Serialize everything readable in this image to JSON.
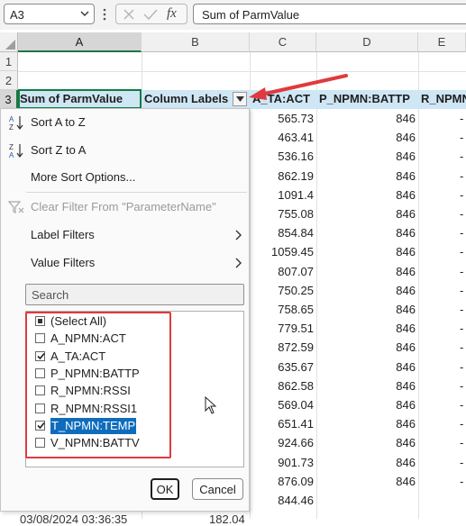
{
  "formula_bar": {
    "name_box": "A3",
    "fx_label": "fx",
    "formula": "Sum of ParmValue"
  },
  "grid": {
    "columns": [
      "A",
      "B",
      "C",
      "D",
      "E"
    ],
    "rows": [
      "1",
      "2",
      "3"
    ],
    "pivot_header": {
      "a3": "Sum of ParmValue",
      "b3": "Column Labels",
      "c3": "A_TA:ACT",
      "d3": "P_NPMN:BATTP",
      "e3": "R_NPMN"
    },
    "values_c": [
      "565.73",
      "463.41",
      "536.16",
      "862.19",
      "1091.4",
      "755.08",
      "854.84",
      "1059.45",
      "807.07",
      "750.25",
      "758.65",
      "779.51",
      "872.59",
      "635.67",
      "862.58",
      "569.04",
      "651.41",
      "924.66",
      "901.73",
      "876.09",
      "844.46"
    ],
    "values_d": [
      "846",
      "846",
      "846",
      "846",
      "846",
      "846",
      "846",
      "846",
      "846",
      "846",
      "846",
      "846",
      "846",
      "846",
      "846",
      "846",
      "846",
      "846",
      "846",
      "846"
    ],
    "bottom_row_a": "03/08/2024 03:36:35",
    "bottom_row_b": "182.04"
  },
  "filter_menu": {
    "sort_az": "Sort A to Z",
    "sort_za": "Sort Z to A",
    "more_sort": "More Sort Options...",
    "clear_filter": "Clear Filter From \"ParameterName\"",
    "label_filters": "Label Filters",
    "value_filters": "Value Filters",
    "search_placeholder": "Search",
    "items": [
      {
        "label": "(Select All)",
        "state": "partial"
      },
      {
        "label": "A_NPMN:ACT",
        "state": "unchecked"
      },
      {
        "label": "A_TA:ACT",
        "state": "checked"
      },
      {
        "label": "P_NPMN:BATTP",
        "state": "unchecked"
      },
      {
        "label": "R_NPMN:RSSI",
        "state": "unchecked"
      },
      {
        "label": "R_NPMN:RSSI1",
        "state": "unchecked"
      },
      {
        "label": "T_NPMN:TEMP",
        "state": "checked"
      },
      {
        "label": "V_NPMN:BATTV",
        "state": "unchecked"
      }
    ],
    "ok": "OK",
    "cancel": "Cancel"
  },
  "icons": {
    "sort_az": "sort-ascending-icon",
    "sort_za": "sort-descending-icon",
    "clear_filter": "clear-filter-icon",
    "submenu": "chevron-right-icon",
    "filter_dropdown": "filter-dropdown-icon",
    "cursor": "mouse-pointer-icon"
  },
  "colors": {
    "pivot_band": "#cfe6f5",
    "selection": "#107c41",
    "annotation": "#e03a3e",
    "highlight": "#0f6cbd"
  }
}
